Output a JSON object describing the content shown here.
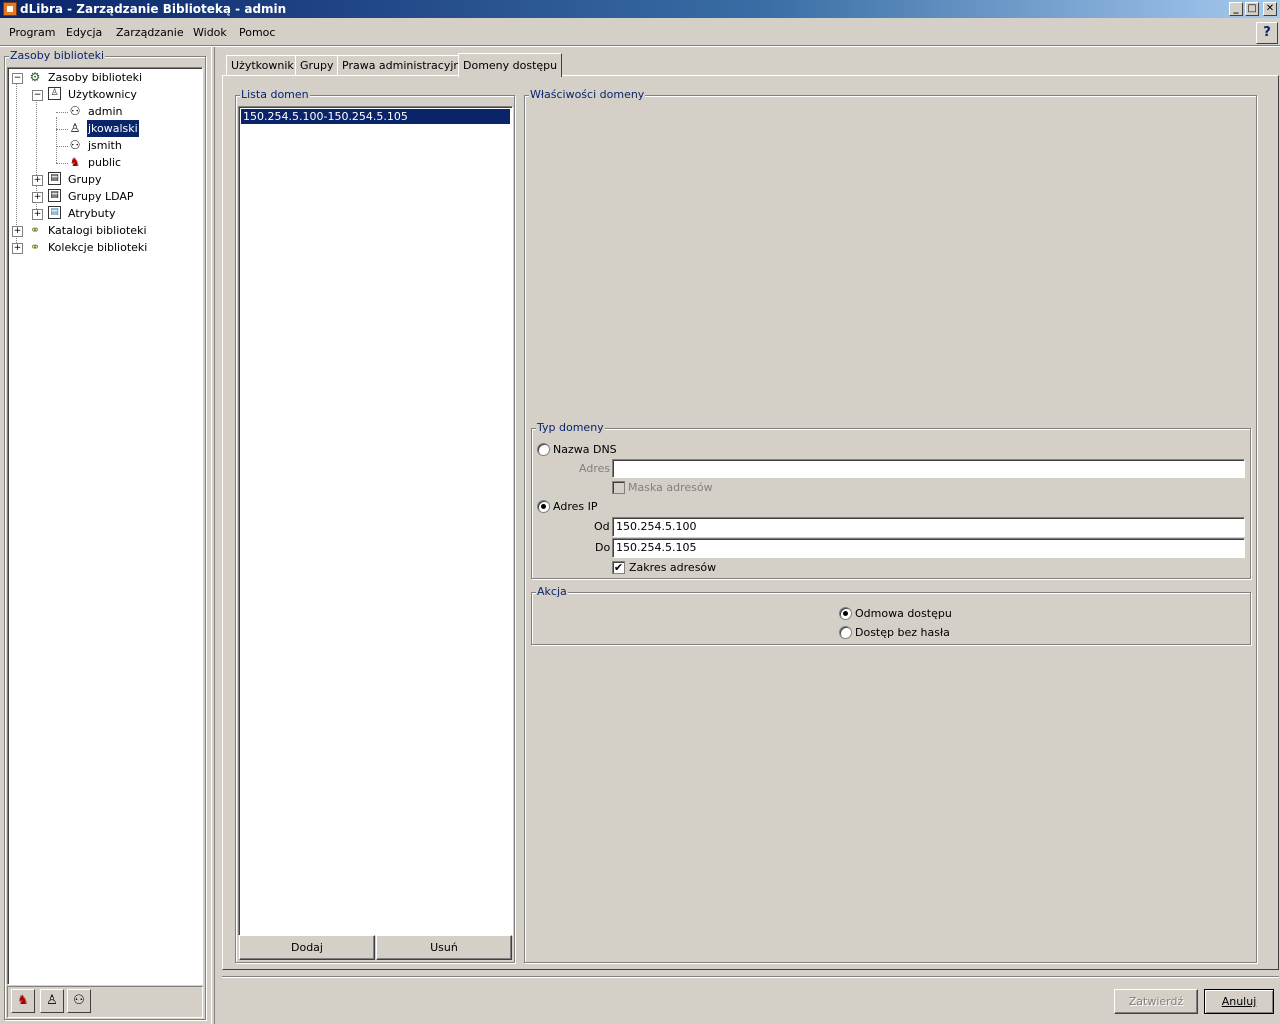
{
  "window": {
    "title": "dLibra - Zarządzanie Biblioteką - admin",
    "min": "_",
    "max": "□",
    "close": "✕"
  },
  "menu": [
    "Program",
    "Edycja",
    "Zarządzanie",
    "Widok",
    "Pomoc"
  ],
  "help_glyph": "?",
  "left_panel": {
    "title": "Zasoby biblioteki",
    "tree": {
      "root": "Zasoby biblioteki",
      "users": "Użytkownicy",
      "user_items": [
        "admin",
        "jkowalski",
        "jsmith",
        "public"
      ],
      "groups": "Grupy",
      "ldap_groups": "Grupy LDAP",
      "attributes": "Atrybuty",
      "catalogs": "Katalogi biblioteki",
      "collections": "Kolekcje biblioteki"
    },
    "selected": "jkowalski"
  },
  "tabs": [
    "Użytkownik",
    "Grupy",
    "Prawa administracyjne",
    "Domeny dostępu"
  ],
  "active_tab": "Domeny dostępu",
  "domain_list": {
    "title": "Lista domen",
    "items": [
      "150.254.5.100-150.254.5.105"
    ],
    "add": "Dodaj",
    "remove": "Usuń"
  },
  "properties": {
    "title": "Właściwości domeny",
    "type": {
      "title": "Typ domeny",
      "dns_label": "Nazwa DNS",
      "dns_selected": false,
      "address_label": "Adres",
      "address_value": "",
      "mask_label": "Maska adresów",
      "mask_checked": false,
      "ip_label": "Adres IP",
      "ip_selected": true,
      "from_label": "Od",
      "from_value": "150.254.5.100",
      "to_label": "Do",
      "to_value": "150.254.5.105",
      "range_label": "Zakres adresów",
      "range_checked": true
    },
    "action": {
      "title": "Akcja",
      "deny_label": "Odmowa dostępu",
      "deny_selected": true,
      "nopass_label": "Dostęp bez hasła",
      "nopass_selected": false
    }
  },
  "footer": {
    "confirm": "Zatwierdź",
    "cancel": "Anuluj"
  },
  "check_glyph": "✔",
  "expand_minus": "−",
  "expand_plus": "+",
  "icons": {
    "tree_root": "⚙",
    "folder": "▤",
    "user_admin": "⚇",
    "user": "♙",
    "user_public": "♞",
    "catalog": "⚭"
  }
}
